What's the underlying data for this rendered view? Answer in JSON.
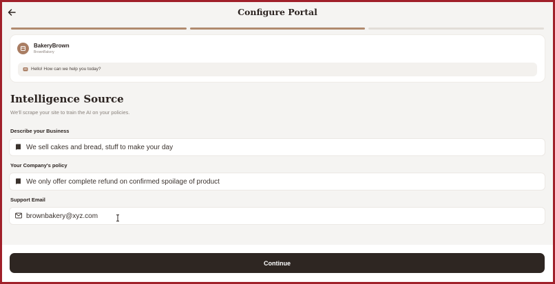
{
  "header": {
    "title": "Configure Portal",
    "back_icon": "arrow-left-icon"
  },
  "progress": {
    "total_steps": 3,
    "completed_steps": 2
  },
  "preview": {
    "brand_name": "BakeryBrown",
    "brand_handle": "BrownBakery",
    "greeting": "Hello! How can we help you today?",
    "avatar_color": "#a97d63"
  },
  "section": {
    "title": "Intelligence Source",
    "subtitle": "We'll scrape your site to train the AI on your policies."
  },
  "fields": [
    {
      "label": "Describe your Business",
      "value": "We sell cakes and bread, stuff to make your day",
      "icon": "book-icon"
    },
    {
      "label": "Your Company's policy",
      "value": "We only offer complete refund on confirmed spoilage of product",
      "icon": "book-icon"
    },
    {
      "label": "Support Email",
      "value": "brownbakery@xyz.com",
      "icon": "mail-icon"
    }
  ],
  "footer": {
    "continue_label": "Continue"
  },
  "colors": {
    "accent": "#b08a6e",
    "dark": "#2e2622",
    "border": "#a0202a"
  }
}
